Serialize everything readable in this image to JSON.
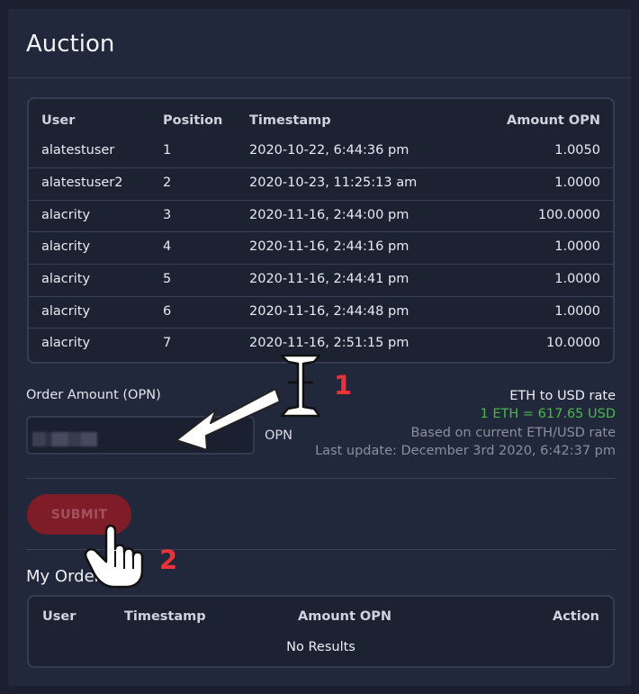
{
  "card": {
    "title": "Auction"
  },
  "auction_table": {
    "columns": [
      "User",
      "Position",
      "Timestamp",
      "Amount OPN"
    ],
    "rows": [
      {
        "user": "alatestuser",
        "position": "1",
        "timestamp": "2020-10-22, 6:44:36 pm",
        "amount": "1.0050"
      },
      {
        "user": "alatestuser2",
        "position": "2",
        "timestamp": "2020-10-23, 11:25:13 am",
        "amount": "1.0000"
      },
      {
        "user": "alacrity",
        "position": "3",
        "timestamp": "2020-11-16, 2:44:00 pm",
        "amount": "100.0000"
      },
      {
        "user": "alacrity",
        "position": "4",
        "timestamp": "2020-11-16, 2:44:16 pm",
        "amount": "1.0000"
      },
      {
        "user": "alacrity",
        "position": "5",
        "timestamp": "2020-11-16, 2:44:41 pm",
        "amount": "1.0000"
      },
      {
        "user": "alacrity",
        "position": "6",
        "timestamp": "2020-11-16, 2:44:48 pm",
        "amount": "1.0000"
      },
      {
        "user": "alacrity",
        "position": "7",
        "timestamp": "2020-11-16, 2:51:15 pm",
        "amount": "10.0000"
      }
    ]
  },
  "order_form": {
    "label": "Order Amount (OPN)",
    "unit": "OPN",
    "submit_label": "SUBMIT"
  },
  "rate": {
    "title": "ETH to USD rate",
    "value": "1 ETH = 617.65 USD",
    "basis": "Based on current ETH/USD rate",
    "last_update": "Last update: December 3rd 2020, 6:42:37 pm"
  },
  "my_orders": {
    "title": "My Orders",
    "columns": [
      "User",
      "Timestamp",
      "Amount OPN",
      "Action"
    ],
    "empty_text": "No Results"
  },
  "annotations": {
    "step1": "1",
    "step2": "2",
    "icons": [
      "text-cursor-icon",
      "arrow-icon",
      "hand-pointer-icon"
    ],
    "number_color": "#e8333a"
  },
  "colors": {
    "accent_green": "#4bb74e",
    "submit_bg": "#7e1c28",
    "panel_bg": "#22283b"
  }
}
